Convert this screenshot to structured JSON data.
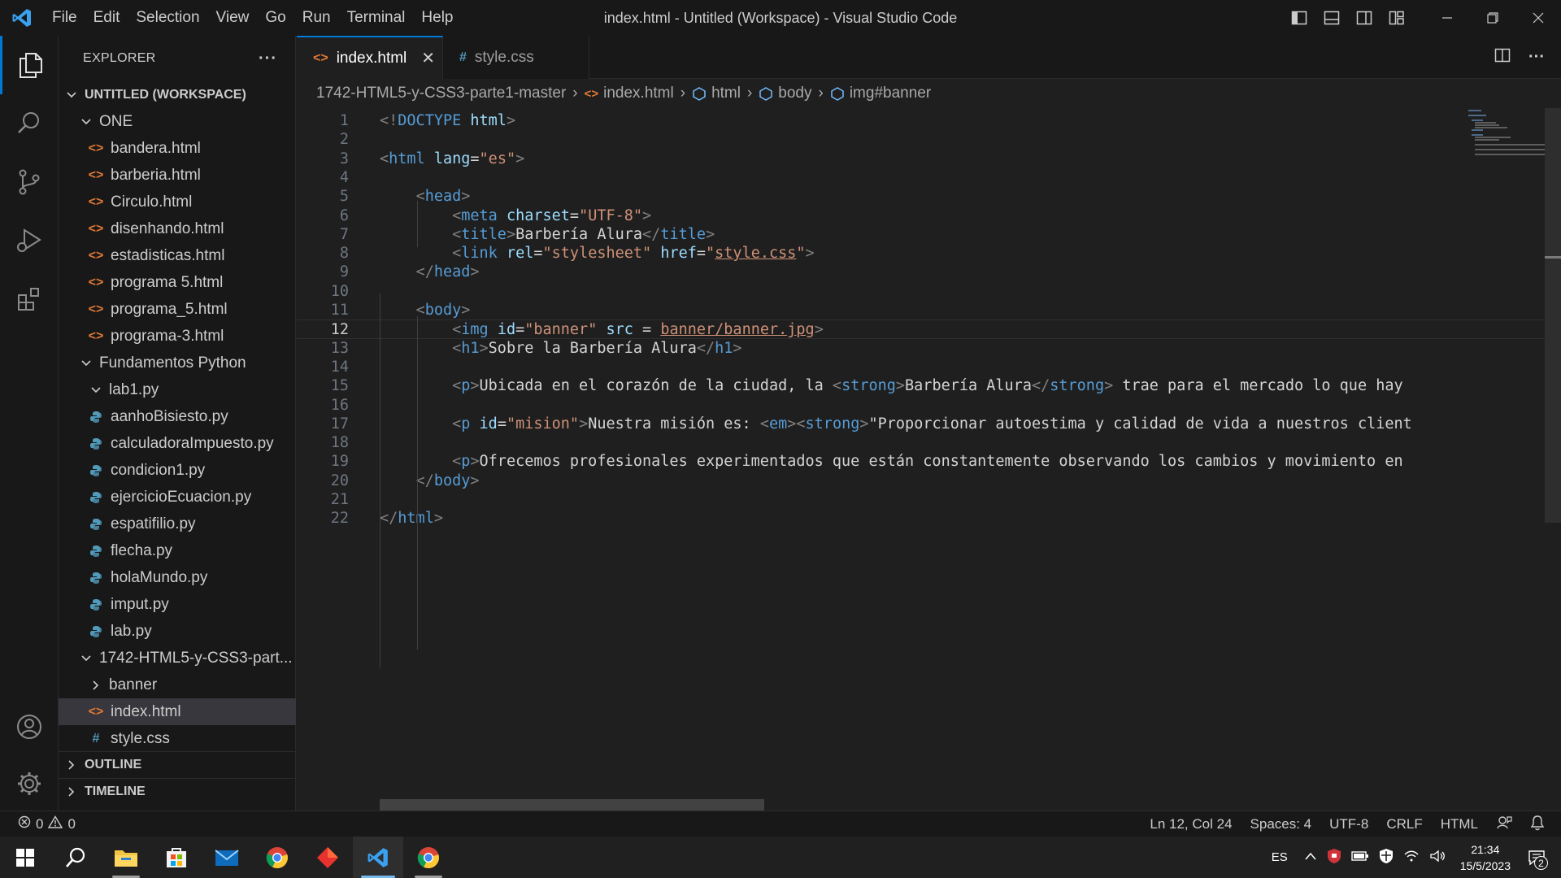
{
  "titlebar": {
    "menu": [
      "File",
      "Edit",
      "Selection",
      "View",
      "Go",
      "Run",
      "Terminal",
      "Help"
    ],
    "window_title": "index.html - Untitled (Workspace) - Visual Studio Code"
  },
  "sidebar": {
    "title": "EXPLORER",
    "more": "···",
    "workspace": "UNTITLED (WORKSPACE)",
    "items": [
      {
        "label": "ONE",
        "type": "folder"
      },
      {
        "label": "bandera.html",
        "type": "html"
      },
      {
        "label": "barberia.html",
        "type": "html"
      },
      {
        "label": "Circulo.html",
        "type": "html"
      },
      {
        "label": "disenhando.html",
        "type": "html"
      },
      {
        "label": "estadisticas.html",
        "type": "html"
      },
      {
        "label": "programa 5.html",
        "type": "html"
      },
      {
        "label": "programa_5.html",
        "type": "html"
      },
      {
        "label": "programa-3.html",
        "type": "html"
      },
      {
        "label": "Fundamentos Python",
        "type": "folder"
      },
      {
        "label": "lab1.py",
        "type": "folder"
      },
      {
        "label": "aanhoBisiesto.py",
        "type": "py"
      },
      {
        "label": "calculadoraImpuesto.py",
        "type": "py"
      },
      {
        "label": "condicion1.py",
        "type": "py"
      },
      {
        "label": "ejercicioEcuacion.py",
        "type": "py"
      },
      {
        "label": "espatifilio.py",
        "type": "py"
      },
      {
        "label": "flecha.py",
        "type": "py"
      },
      {
        "label": "holaMundo.py",
        "type": "py"
      },
      {
        "label": "imput.py",
        "type": "py"
      },
      {
        "label": "lab.py",
        "type": "py"
      },
      {
        "label": "1742-HTML5-y-CSS3-part...",
        "type": "folder"
      },
      {
        "label": "banner",
        "type": "folder-collapsed"
      },
      {
        "label": "index.html",
        "type": "html",
        "selected": true
      },
      {
        "label": "style.css",
        "type": "css"
      }
    ],
    "outline": "OUTLINE",
    "timeline": "TIMELINE"
  },
  "tabs": [
    {
      "label": "index.html",
      "icon": "<>",
      "active": true,
      "close": "✕"
    },
    {
      "label": "style.css",
      "icon": "#",
      "active": false
    }
  ],
  "breadcrumb": {
    "folder": "1742-HTML5-y-CSS3-parte1-master",
    "file": "index.html",
    "html": "html",
    "body": "body",
    "img": "img#banner"
  },
  "editor": {
    "current_line": 12,
    "lines": [
      {
        "n": "1",
        "tokens": [
          [
            "p",
            "<!"
          ],
          [
            "tag",
            "DOCTYPE"
          ],
          [
            "t",
            " "
          ],
          [
            "attr",
            "html"
          ],
          [
            "p",
            ">"
          ]
        ]
      },
      {
        "n": "2",
        "tokens": []
      },
      {
        "n": "3",
        "tokens": [
          [
            "p",
            "<"
          ],
          [
            "tag",
            "html"
          ],
          [
            "t",
            " "
          ],
          [
            "attr",
            "lang"
          ],
          [
            "t",
            "="
          ],
          [
            "str",
            "\"es\""
          ],
          [
            "p",
            ">"
          ]
        ]
      },
      {
        "n": "4",
        "tokens": []
      },
      {
        "n": "5",
        "tokens": [
          [
            "t",
            "    "
          ],
          [
            "p",
            "<"
          ],
          [
            "tag",
            "head"
          ],
          [
            "p",
            ">"
          ]
        ]
      },
      {
        "n": "6",
        "tokens": [
          [
            "t",
            "        "
          ],
          [
            "p",
            "<"
          ],
          [
            "tag",
            "meta"
          ],
          [
            "t",
            " "
          ],
          [
            "attr",
            "charset"
          ],
          [
            "t",
            "="
          ],
          [
            "str",
            "\"UTF-8\""
          ],
          [
            "p",
            ">"
          ]
        ]
      },
      {
        "n": "7",
        "tokens": [
          [
            "t",
            "        "
          ],
          [
            "p",
            "<"
          ],
          [
            "tag",
            "title"
          ],
          [
            "p",
            ">"
          ],
          [
            "t",
            "Barbería Alura"
          ],
          [
            "p",
            "</"
          ],
          [
            "tag",
            "title"
          ],
          [
            "p",
            ">"
          ]
        ]
      },
      {
        "n": "8",
        "tokens": [
          [
            "t",
            "        "
          ],
          [
            "p",
            "<"
          ],
          [
            "tag",
            "link"
          ],
          [
            "t",
            " "
          ],
          [
            "attr",
            "rel"
          ],
          [
            "t",
            "="
          ],
          [
            "str",
            "\"stylesheet\""
          ],
          [
            "t",
            " "
          ],
          [
            "attr",
            "href"
          ],
          [
            "t",
            "="
          ],
          [
            "str",
            "\""
          ],
          [
            "link",
            "style.css"
          ],
          [
            "str",
            "\""
          ],
          [
            "p",
            ">"
          ]
        ]
      },
      {
        "n": "9",
        "tokens": [
          [
            "t",
            "    "
          ],
          [
            "p",
            "</"
          ],
          [
            "tag",
            "head"
          ],
          [
            "p",
            ">"
          ]
        ]
      },
      {
        "n": "10",
        "tokens": []
      },
      {
        "n": "11",
        "tokens": [
          [
            "t",
            "    "
          ],
          [
            "p",
            "<"
          ],
          [
            "tag",
            "body"
          ],
          [
            "p",
            ">"
          ]
        ]
      },
      {
        "n": "12",
        "tokens": [
          [
            "t",
            "        "
          ],
          [
            "p",
            "<"
          ],
          [
            "tag",
            "img"
          ],
          [
            "t",
            " "
          ],
          [
            "attr",
            "id"
          ],
          [
            "t",
            "="
          ],
          [
            "str",
            "\"banner\""
          ],
          [
            "t",
            " "
          ],
          [
            "attr",
            "src"
          ],
          [
            "t",
            " = "
          ],
          [
            "link",
            "banner/banner.jpg"
          ],
          [
            "p",
            ">"
          ]
        ]
      },
      {
        "n": "13",
        "tokens": [
          [
            "t",
            "        "
          ],
          [
            "p",
            "<"
          ],
          [
            "tag",
            "h1"
          ],
          [
            "p",
            ">"
          ],
          [
            "t",
            "Sobre la Barbería Alura"
          ],
          [
            "p",
            "</"
          ],
          [
            "tag",
            "h1"
          ],
          [
            "p",
            ">"
          ]
        ]
      },
      {
        "n": "14",
        "tokens": []
      },
      {
        "n": "15",
        "tokens": [
          [
            "t",
            "        "
          ],
          [
            "p",
            "<"
          ],
          [
            "tag",
            "p"
          ],
          [
            "p",
            ">"
          ],
          [
            "t",
            "Ubicada en el corazón de la ciudad, la "
          ],
          [
            "p",
            "<"
          ],
          [
            "tag",
            "strong"
          ],
          [
            "p",
            ">"
          ],
          [
            "t",
            "Barbería Alura"
          ],
          [
            "p",
            "</"
          ],
          [
            "tag",
            "strong"
          ],
          [
            "p",
            ">"
          ],
          [
            "t",
            " trae para el mercado lo que hay"
          ]
        ]
      },
      {
        "n": "16",
        "tokens": []
      },
      {
        "n": "17",
        "tokens": [
          [
            "t",
            "        "
          ],
          [
            "p",
            "<"
          ],
          [
            "tag",
            "p"
          ],
          [
            "t",
            " "
          ],
          [
            "attr",
            "id"
          ],
          [
            "t",
            "="
          ],
          [
            "str",
            "\"mision\""
          ],
          [
            "p",
            ">"
          ],
          [
            "t",
            "Nuestra misión es: "
          ],
          [
            "p",
            "<"
          ],
          [
            "tag",
            "em"
          ],
          [
            "p",
            "><"
          ],
          [
            "tag",
            "strong"
          ],
          [
            "p",
            ">"
          ],
          [
            "t",
            "\"Proporcionar autoestima y calidad de vida a nuestros client"
          ]
        ]
      },
      {
        "n": "18",
        "tokens": []
      },
      {
        "n": "19",
        "tokens": [
          [
            "t",
            "        "
          ],
          [
            "p",
            "<"
          ],
          [
            "tag",
            "p"
          ],
          [
            "p",
            ">"
          ],
          [
            "t",
            "Ofrecemos profesionales experimentados que están constantemente observando los cambios y movimiento en"
          ]
        ]
      },
      {
        "n": "20",
        "tokens": [
          [
            "t",
            "    "
          ],
          [
            "p",
            "</"
          ],
          [
            "tag",
            "body"
          ],
          [
            "p",
            ">"
          ]
        ]
      },
      {
        "n": "21",
        "tokens": []
      },
      {
        "n": "22",
        "tokens": [
          [
            "p",
            "</"
          ],
          [
            "tag",
            "html"
          ],
          [
            "p",
            ">"
          ]
        ]
      }
    ]
  },
  "statusbar": {
    "errors": "0",
    "warnings": "0",
    "position": "Ln 12, Col 24",
    "spaces": "Spaces: 4",
    "encoding": "UTF-8",
    "eol": "CRLF",
    "language": "HTML"
  },
  "taskbar": {
    "lang": "ES",
    "time": "21:34",
    "date": "15/5/2023",
    "notifications": "2"
  },
  "colors": {
    "accent": "#0078d4",
    "html_icon": "#e37933",
    "py_icon": "#519aba"
  }
}
